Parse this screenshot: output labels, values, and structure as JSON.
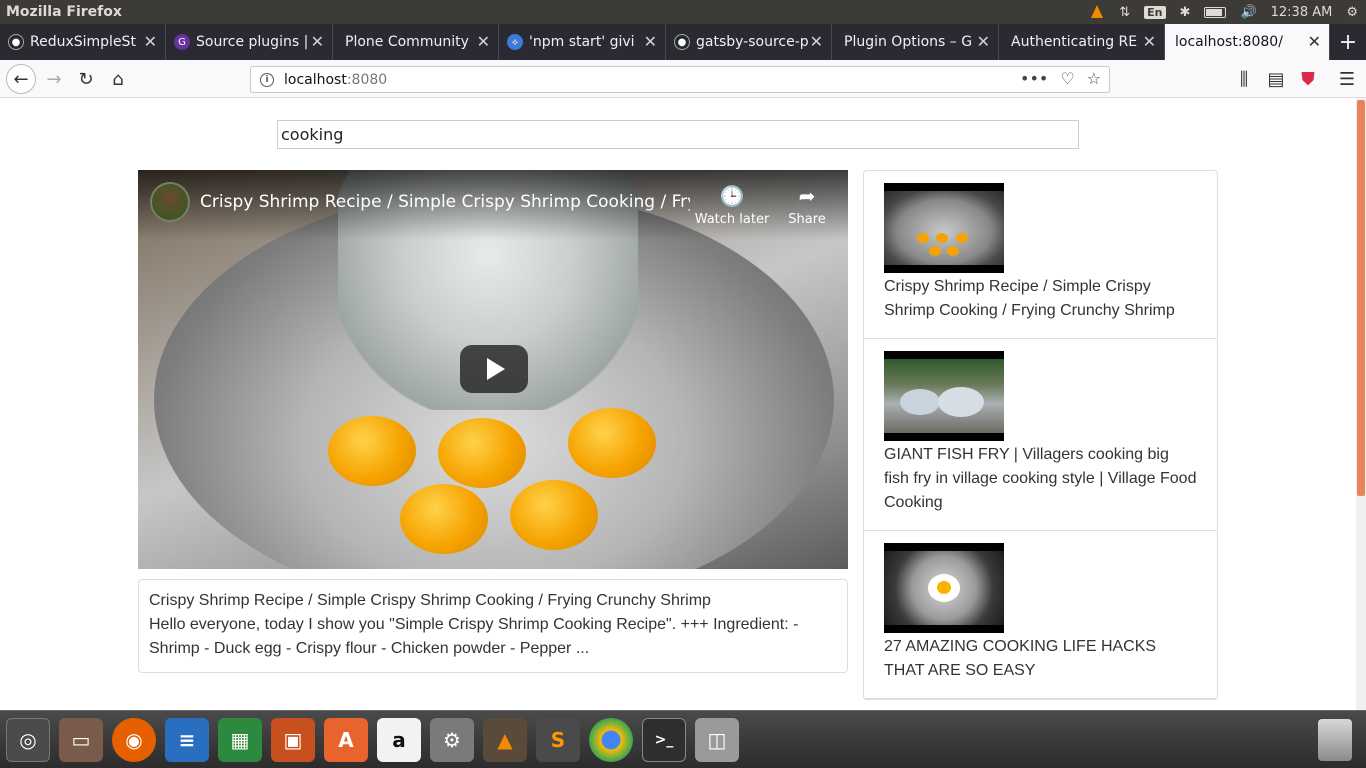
{
  "system": {
    "app_title": "Mozilla Firefox",
    "keyboard_layout": "En",
    "clock": "12:38 AM",
    "indicator_icons": [
      "vlc-icon",
      "network-icon",
      "keyboard-icon",
      "bluetooth-icon",
      "battery-icon",
      "volume-icon",
      "settings-icon"
    ]
  },
  "browser": {
    "tabs": [
      {
        "label": "ReduxSimpleSt",
        "icon": "github-icon",
        "color": "#24292e"
      },
      {
        "label": "Source plugins |",
        "icon": "gatsby-icon",
        "color": "#663399"
      },
      {
        "label": "Plone Community",
        "icon": "none",
        "color": "#2b2a33"
      },
      {
        "label": "'npm start' givi",
        "icon": "globe-icon",
        "color": "#3d7bd6"
      },
      {
        "label": "gatsby-source-p",
        "icon": "github-icon",
        "color": "#24292e"
      },
      {
        "label": "Plugin Options – G",
        "icon": "none",
        "color": "#2b2a33"
      },
      {
        "label": "Authenticating RE",
        "icon": "none",
        "color": "#2b2a33"
      },
      {
        "label": "localhost:8080/",
        "icon": "none",
        "color": "#2b2a33",
        "active": true
      }
    ],
    "new_tab_symbol": "+",
    "url_host": "localhost",
    "url_port": ":8080"
  },
  "page": {
    "search": {
      "value": "cooking"
    },
    "player": {
      "title": "Crispy Shrimp Recipe / Simple Crispy Shrimp Cooking / Fryi...",
      "watch_later": "Watch later",
      "share": "Share"
    },
    "details": {
      "title": "Crispy Shrimp Recipe / Simple Crispy Shrimp Cooking / Frying Crunchy Shrimp",
      "description": "Hello everyone, today I show you \"Simple Crispy Shrimp Cooking Recipe\". +++ Ingredient: - Shrimp - Duck egg - Crispy flour - Chicken powder - Pepper ..."
    },
    "videos": [
      {
        "title": "Crispy Shrimp Recipe / Simple Crispy Shrimp Cooking / Frying Crunchy Shrimp",
        "thumb": "shrimp-bowl"
      },
      {
        "title": "GIANT FISH FRY | Villagers cooking big fish fry in village cooking style | Village Food Cooking",
        "thumb": "fish"
      },
      {
        "title": "27 AMAZING COOKING LIFE HACKS THAT ARE SO EASY",
        "thumb": "egg-pan"
      }
    ]
  },
  "dock": {
    "apps": [
      "ubuntu-icon",
      "files-icon",
      "firefox-icon",
      "writer-icon",
      "calc-icon",
      "impress-icon",
      "software-icon",
      "amazon-icon",
      "settings-icon",
      "vlc-icon",
      "sublime-icon",
      "chrome-icon",
      "terminal-icon",
      "disk-icon",
      "trash-icon"
    ]
  }
}
